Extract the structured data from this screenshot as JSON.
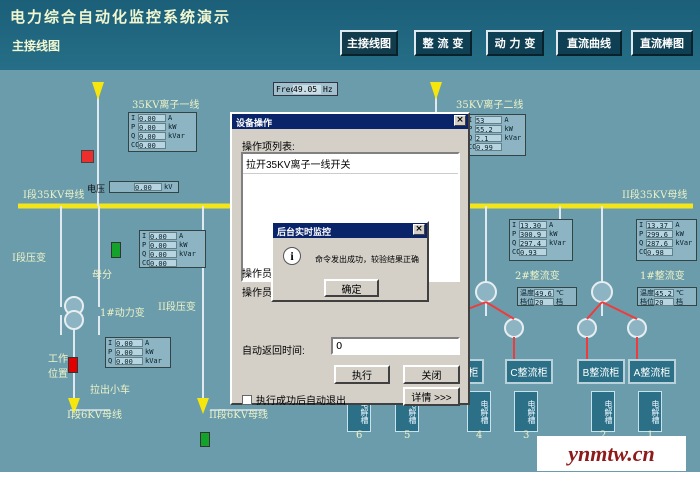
{
  "app": {
    "title": "电力综合自动化监控系统演示",
    "subtitle": "主接线图"
  },
  "nav": [
    {
      "label": "主接线图"
    },
    {
      "label": "整 流 变"
    },
    {
      "label": "动 力 变"
    },
    {
      "label": "直流曲线"
    },
    {
      "label": "直流棒图"
    }
  ],
  "bus": {
    "line1": "35KV离子一线",
    "line2": "35KV离子二线",
    "bus_1": "I段35KV母线",
    "bus_2": "II段35KV母线",
    "voltage_label": "电压",
    "voltage_value": "0.00",
    "voltage_unit": "kV",
    "busbar6_1": "I段6KV母线",
    "busbar6_2": "II段6KV母线",
    "pt_1": "I段压变",
    "pt_2": "II段压变",
    "bus_coupler": "母分",
    "motor1": "1#动力变",
    "work_pos": "工作位置",
    "cart": "拉出小车",
    "rect2": "2#整流变",
    "rect1": "1#整流变"
  },
  "frequency": {
    "label": "Freq",
    "value": "49.05",
    "unit": "Hz"
  },
  "meters": {
    "line1": [
      {
        "key": "I",
        "value": "0.00",
        "unit": "A"
      },
      {
        "key": "P",
        "value": "0.00",
        "unit": "kW"
      },
      {
        "key": "Q",
        "value": "0.00",
        "unit": "kVar"
      },
      {
        "key": "COSΦ",
        "value": "0.00",
        "unit": ""
      }
    ],
    "line2": [
      {
        "key": "I",
        "value": "53",
        "unit": "A"
      },
      {
        "key": "P",
        "value": "55.2",
        "unit": "kW"
      },
      {
        "key": "Q",
        "value": "2.1",
        "unit": "kVar"
      },
      {
        "key": "COSΦ",
        "value": "0.99",
        "unit": ""
      }
    ],
    "pt": [
      {
        "key": "I",
        "value": "0.00",
        "unit": "A"
      },
      {
        "key": "P",
        "value": "0.00",
        "unit": "kW"
      },
      {
        "key": "Q",
        "value": "0.00",
        "unit": "kVar"
      },
      {
        "key": "COSΦ",
        "value": "0.00",
        "unit": ""
      }
    ],
    "motor": [
      {
        "key": "I",
        "value": "0.00",
        "unit": "A"
      },
      {
        "key": "P",
        "value": "0.00",
        "unit": "kW"
      },
      {
        "key": "Q",
        "value": "0.00",
        "unit": "kVar"
      }
    ],
    "rect2": [
      {
        "key": "I",
        "value": "13.30",
        "unit": "A"
      },
      {
        "key": "P",
        "value": "300.9",
        "unit": "kW"
      },
      {
        "key": "Q",
        "value": "297.4",
        "unit": "kVar"
      },
      {
        "key": "COSΦ",
        "value": "0.93",
        "unit": ""
      }
    ],
    "rect1": [
      {
        "key": "I",
        "value": "13.37",
        "unit": "A"
      },
      {
        "key": "P",
        "value": "299.6",
        "unit": "kW"
      },
      {
        "key": "Q",
        "value": "287.6",
        "unit": "kVar"
      },
      {
        "key": "COSΦ",
        "value": "0.98",
        "unit": ""
      }
    ],
    "temp2": {
      "temp_label": "温度",
      "temp_value": "49.6",
      "temp_unit": "℃",
      "pos_label": "档位",
      "pos_value": "20",
      "pos_unit": "档"
    },
    "temp1": {
      "temp_label": "温度",
      "temp_value": "45.2",
      "temp_unit": "℃",
      "pos_label": "档位",
      "pos_value": "20",
      "pos_unit": "档"
    }
  },
  "cabinets": [
    "A整流柜",
    "B整流柜",
    "C整流柜",
    "A整流柜"
  ],
  "electrolysis": [
    "电解槽",
    "电解槽",
    "电解槽",
    "电解槽",
    "电解槽",
    "电解槽"
  ],
  "electrolysis_nums": [
    "6",
    "5",
    "4",
    "3",
    "2",
    "1"
  ],
  "dialog_device": {
    "title": "设备操作",
    "list_label": "操作项列表:",
    "list_item": "拉开35KV离子一线开关",
    "operator1": "操作员",
    "operator2": "操作员",
    "return_label": "自动返回时间:",
    "return_value": "0",
    "execute": "执行",
    "close": "关闭",
    "auto_exit": "执行成功后自动退出",
    "details": "详情 >>>"
  },
  "dialog_monitor": {
    "title": "后台实时监控",
    "message": "命令发出成功，较验结果正确",
    "ok": "确定",
    "info_icon": "i"
  },
  "watermark": "ynmtw.cn",
  "colors": {
    "bus_yellow": "#f0e40c",
    "background": "#6b9cac",
    "header": "#1b5f79",
    "breaker_red": "#e30000",
    "breaker_green": "#0b9c23"
  }
}
